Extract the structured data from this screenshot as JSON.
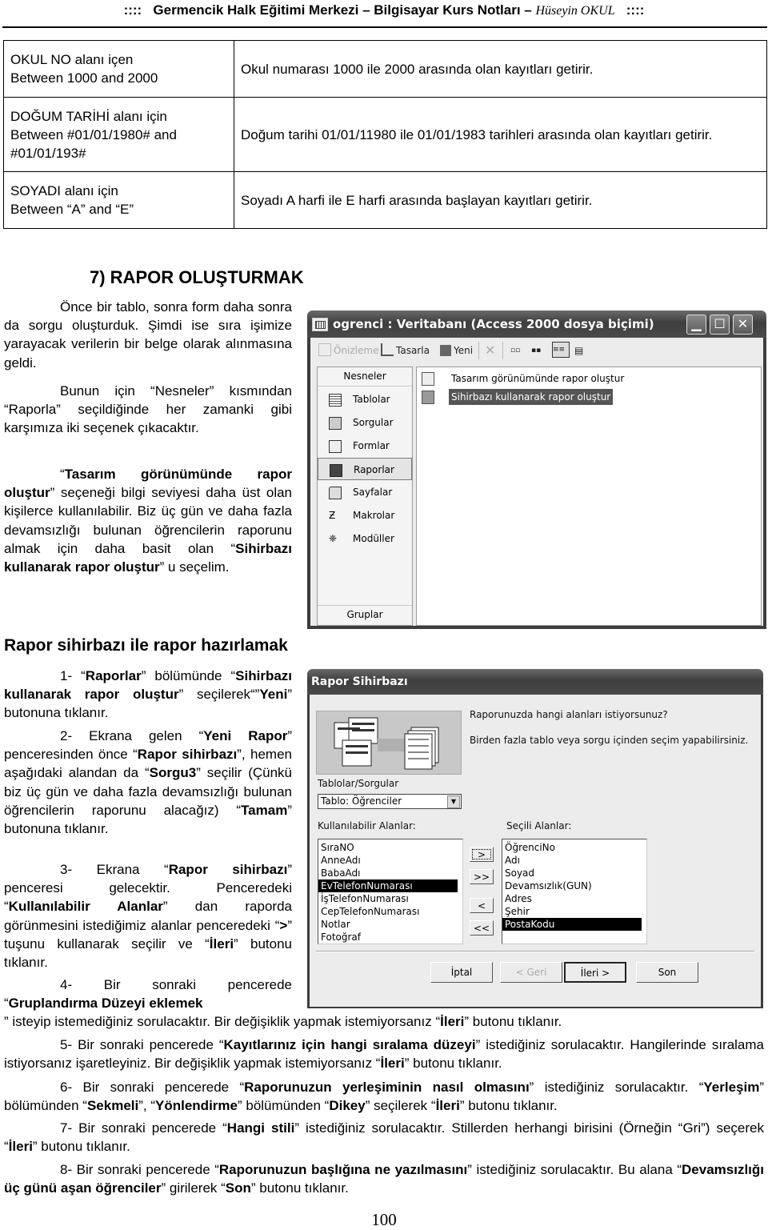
{
  "header": {
    "prefix": "::::",
    "title": "Germencik Halk Eğitimi Merkezi – Bilgisayar Kurs Notları –",
    "author": "Hüseyin OKUL",
    "suffix": "::::"
  },
  "criteria_table": {
    "rows": [
      {
        "criterion_line1": "OKUL NO alanı içen",
        "criterion_line2": "Between 1000 and 2000",
        "criterion_line3": "",
        "description": "Okul numarası 1000 ile 2000 arasında olan kayıtları getirir."
      },
      {
        "criterion_line1": "DOĞUM TARİHİ alanı için",
        "criterion_line2": "Between #01/01/1980# and",
        "criterion_line3": "#01/01/193#",
        "description": "Doğum tarihi 01/01/11980 ile 01/01/1983 tarihleri arasında olan kayıtları getirir."
      },
      {
        "criterion_line1": "SOYADI alanı için",
        "criterion_line2": "Between “A” and “E”",
        "criterion_line3": "",
        "description": "Soyadı A harfi ile E harfi arasında başlayan kayıtları getirir."
      }
    ]
  },
  "section7": {
    "title": "7) RAPOR OLUŞTURMAK",
    "p1": "Önce bir tablo, sonra form daha sonra da sorgu oluşturduk. Şimdi ise sıra işimize yarayacak verilerin bir belge olarak alınmasına geldi.",
    "p2": "Bunun için “Nesneler” kısmından “Raporla” seçildiğinde her zamanki gibi karşımıza iki seçenek çıkacaktır.",
    "p3_q1": "“",
    "p3_b1": "Tasarım görünümünde rapor oluştur",
    "p3_t1": "” seçeneği bilgi seviyesi daha üst olan kişilerce kullanılabilir. Biz üç gün ve daha fazla devamsızlığı bulunan öğrencilerin raporunu almak için daha basit olan “",
    "p3_b2": "Sihirbazı kullanarak rapor oluştur",
    "p3_t2": "” u seçelim."
  },
  "access_window": {
    "title": "ogrenci : Veritabanı (Access 2000 dosya biçimi)",
    "toolbar": {
      "preview": "Önizleme",
      "design": "Tasarla",
      "new": "Yeni"
    },
    "objects_header": "Nesneler",
    "objects": [
      "Tablolar",
      "Sorgular",
      "Formlar",
      "Raporlar",
      "Sayfalar",
      "Makrolar",
      "Modüller"
    ],
    "selected_object": "Raporlar",
    "groups_header": "Gruplar",
    "list": [
      {
        "label": "Tasarım görünümünde rapor oluştur",
        "selected": false
      },
      {
        "label": "Sihirbazı kullanarak rapor oluştur",
        "selected": true
      }
    ]
  },
  "wizard_section": {
    "title": "Rapor sihirbazı ile rapor hazırlamak",
    "s1": {
      "n": "1- ",
      "a": "“",
      "b1": "Raporlar",
      "c": "” bölümünde “",
      "b2": "Sihirbazı kullanarak rapor oluştur",
      "d": "” seçilerek“”",
      "b3": "Yeni",
      "e": "” butonuna tıklanır."
    },
    "s2": {
      "n": "2- Ekrana gelen “",
      "b1": "Yeni Rapor",
      "a": "” penceresinden önce “",
      "b2": "Rapor sihirbazı",
      "b": "”, hemen aşağıdaki alandan da “",
      "b3": "Sorgu3",
      "c": "” seçilir (Çünkü biz üç gün ve daha fazla devamsızlığı bulunan öğrencilerin raporunu alacağız) “",
      "b4": "Tamam",
      "d": "” butonuna tıklanır."
    },
    "s3": {
      "n": "3- Ekrana “",
      "b1": "Rapor sihirbazı",
      "a": "” penceresi gelecektir. Penceredeki “",
      "b2": "Kullanılabilir Alanlar",
      "b": "” dan raporda görünmesini istediğimiz alanlar penceredeki “",
      "b3": ">",
      "c": "” tuşunu kullanarak seçilir ve “",
      "b4": "İleri",
      "d": "” butonu tıklanır."
    },
    "s4": {
      "n": "4- Bir sonraki pencerede “",
      "b1": "Gruplandırma Düzeyi eklemek",
      "a": "” isteyip istemediğiniz sorulacaktır. Bir değişiklik yapmak istemiyorsanız “",
      "b2": "İleri",
      "b": "” butonu tıklanır."
    },
    "s5": {
      "n": "5- Bir sonraki pencerede “",
      "b1": "Kayıtlarınız için hangi sıralama düzeyi",
      "a": "” istediğiniz sorulacaktır. Hangilerinde sıralama istiyorsanız işaretleyiniz. Bir değişiklik yapmak istemiyorsanız “",
      "b2": "İleri",
      "b": "” butonu tıklanır."
    },
    "s6": {
      "n": "6- Bir sonraki pencerede “",
      "b1": "Raporunuzun yerleşiminin nasıl olmasını",
      "a": "” istediğiniz sorulacaktır. “",
      "b2": "Yerleşim",
      "b": "” bölümünden “",
      "b3": "Sekmeli",
      "c": "”, “",
      "b4": "Yönlendirme",
      "d": "” bölümünden “",
      "b5": "Dikey",
      "e": "” seçilerek “",
      "b6": "İleri",
      "f": "” butonu tıklanır."
    },
    "s7": {
      "n": "7- Bir sonraki pencerede “",
      "b1": "Hangi stili",
      "a": "” istediğiniz sorulacaktır. Stillerden herhangi birisini (Örneğin “Gri”) seçerek “",
      "b2": "İleri",
      "b": "” butonu tıklanır."
    },
    "s8": {
      "n": "8- Bir sonraki pencerede “",
      "b1": "Raporunuzun başlığına ne yazılmasını",
      "a": "” istediğiniz sorulacaktır. Bu alana “",
      "b2": "Devamsızlığı üç günü aşan öğrenciler",
      "b": "” girilerek “",
      "b3": "Son",
      "c": "” butonu tıklanır."
    }
  },
  "report_wizard": {
    "title": "Rapor Sihirbazı",
    "question": "Raporunuzda hangi alanları istiyorsunuz?",
    "hint": "Birden fazla tablo veya sorgu içinden seçim yapabilirsiniz.",
    "tables_label": "Tablolar/Sorgular",
    "tables_value": "Tablo: Öğrenciler",
    "available_label": "Kullanılabilir Alanlar:",
    "available_fields": [
      "SıraNO",
      "AnneAdı",
      "BabaAdı",
      "EvTelefonNumarası",
      "İşTelefonNumarası",
      "CepTelefonNumarası",
      "Notlar",
      "Fotoğraf"
    ],
    "available_selected": "EvTelefonNumarası",
    "selected_label": "Seçili Alanlar:",
    "selected_fields": [
      "ÖğrenciNo",
      "Adı",
      "Soyad",
      "Devamsızlık(GUN)",
      "Adres",
      "Şehir",
      "PostaKodu"
    ],
    "selected_selected": "PostaKodu",
    "move_buttons": {
      "one": ">",
      "all": ">>",
      "back_one": "<",
      "back_all": "<<"
    },
    "buttons": {
      "cancel": "İptal",
      "back": "< Geri",
      "next": "İleri >",
      "finish": "Son"
    }
  },
  "page_number": "100"
}
